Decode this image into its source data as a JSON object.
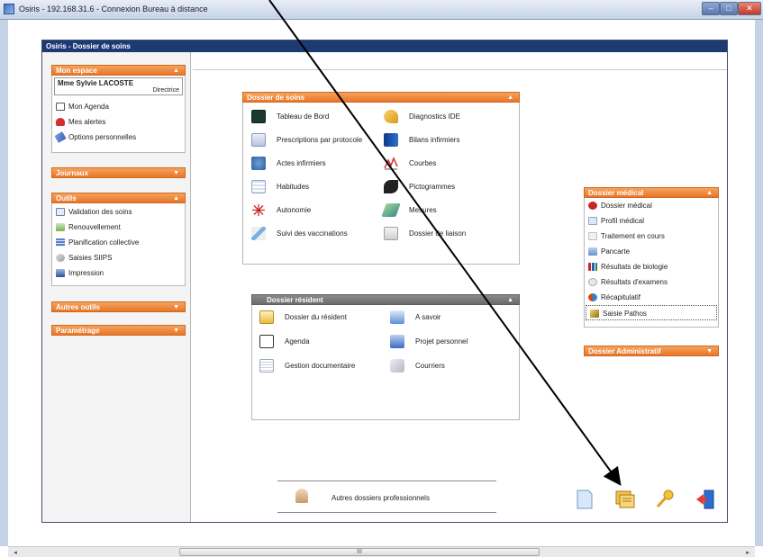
{
  "window": {
    "title": "Osiris - 192.168.31.6 - Connexion Bureau à distance",
    "scroll_thumb_label": "III"
  },
  "app": {
    "title": "Osiris - Dossier de soins"
  },
  "sidebar": {
    "mon_espace": {
      "header": "Mon espace",
      "user_name": "Mme Sylvie LACOSTE",
      "user_role": "Directrice",
      "items": [
        "Mon Agenda",
        "Mes alertes",
        "Options personnelles"
      ]
    },
    "journaux": {
      "header": "Journaux"
    },
    "outils": {
      "header": "Outils",
      "items": [
        "Validation des soins",
        "Renouvellement",
        "Planification collective",
        "Saisies SIIPS",
        "Impression"
      ]
    },
    "autres_outils": {
      "header": "Autres outils"
    },
    "parametrage": {
      "header": "Paramétrage"
    }
  },
  "dossier_soins": {
    "header": "Dossier de soins",
    "items": [
      "Tableau de Bord",
      "Diagnostics IDE",
      "Prescriptions par protocole",
      "Bilans infirmiers",
      "Actes infirmiers",
      "Courbes",
      "Habitudes",
      "Pictogrammes",
      "Autonomie",
      "Mesures",
      "Suivi des vaccinations",
      "Dossier de liaison"
    ]
  },
  "dossier_resident": {
    "header": "Dossier résident",
    "items": [
      "Dossier du résident",
      "A savoir",
      "Agenda",
      "Projet personnel",
      "Gestion documentaire",
      "Courriers"
    ]
  },
  "dossier_medical": {
    "header": "Dossier médical",
    "items": [
      "Dossier médical",
      "Profil médical",
      "Traitement en cours",
      "Pancarte",
      "Résultats de biologie",
      "Résultats d'examens",
      "Récapitulatif",
      "Saisie Pathos"
    ]
  },
  "dossier_administratif": {
    "header": "Dossier Administratif"
  },
  "bottom": {
    "autres_dossiers": "Autres dossiers professionnels"
  },
  "colors": {
    "accent_orange": "#e8762b",
    "app_title_navy": "#1e3a73",
    "resident_header_grey": "#6b6b6b"
  }
}
